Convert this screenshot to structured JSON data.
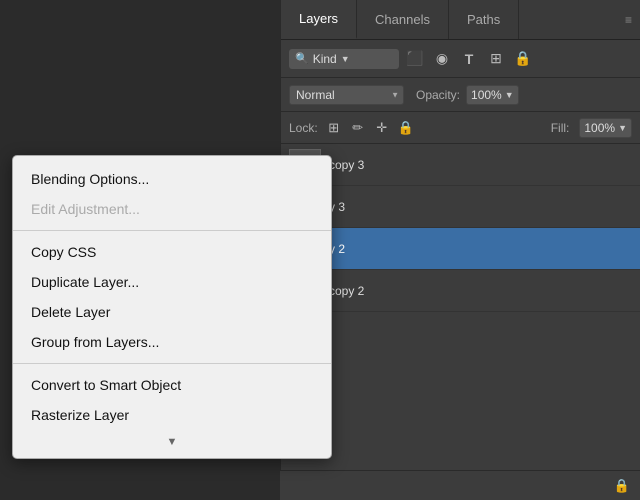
{
  "panel": {
    "tabs": [
      {
        "label": "Layers",
        "active": true
      },
      {
        "label": "Channels",
        "active": false
      },
      {
        "label": "Paths",
        "active": false
      }
    ],
    "toolbar": {
      "search_placeholder": "Kind",
      "icons": [
        "image-icon",
        "circle-icon",
        "text-icon",
        "transform-icon",
        "lock-icon"
      ]
    },
    "blend_mode": {
      "label": "Normal",
      "opacity_label": "Opacity:",
      "opacity_value": "100%"
    },
    "lock_row": {
      "label": "Lock:",
      "icons": [
        "grid-icon",
        "brush-icon",
        "move-icon",
        "lock-icon"
      ],
      "fill_label": "Fill:",
      "fill_value": "100%"
    },
    "layers": [
      {
        "name": "copy 3",
        "selected": false
      },
      {
        "name": "y 3",
        "selected": false
      },
      {
        "name": "y 2",
        "selected": true
      },
      {
        "name": "copy 2",
        "selected": false
      }
    ]
  },
  "context_menu": {
    "items": [
      {
        "label": "Blending Options...",
        "disabled": false,
        "section": 1
      },
      {
        "label": "Edit Adjustment...",
        "disabled": true,
        "section": 1
      },
      {
        "label": "Copy CSS",
        "disabled": false,
        "section": 2
      },
      {
        "label": "Duplicate Layer...",
        "disabled": false,
        "section": 2
      },
      {
        "label": "Delete Layer",
        "disabled": false,
        "section": 2
      },
      {
        "label": "Group from Layers...",
        "disabled": false,
        "section": 2
      },
      {
        "label": "Convert to Smart Object",
        "disabled": false,
        "section": 3
      },
      {
        "label": "Rasterize Layer",
        "disabled": false,
        "section": 3
      }
    ]
  },
  "scroll_indicator": "▼"
}
